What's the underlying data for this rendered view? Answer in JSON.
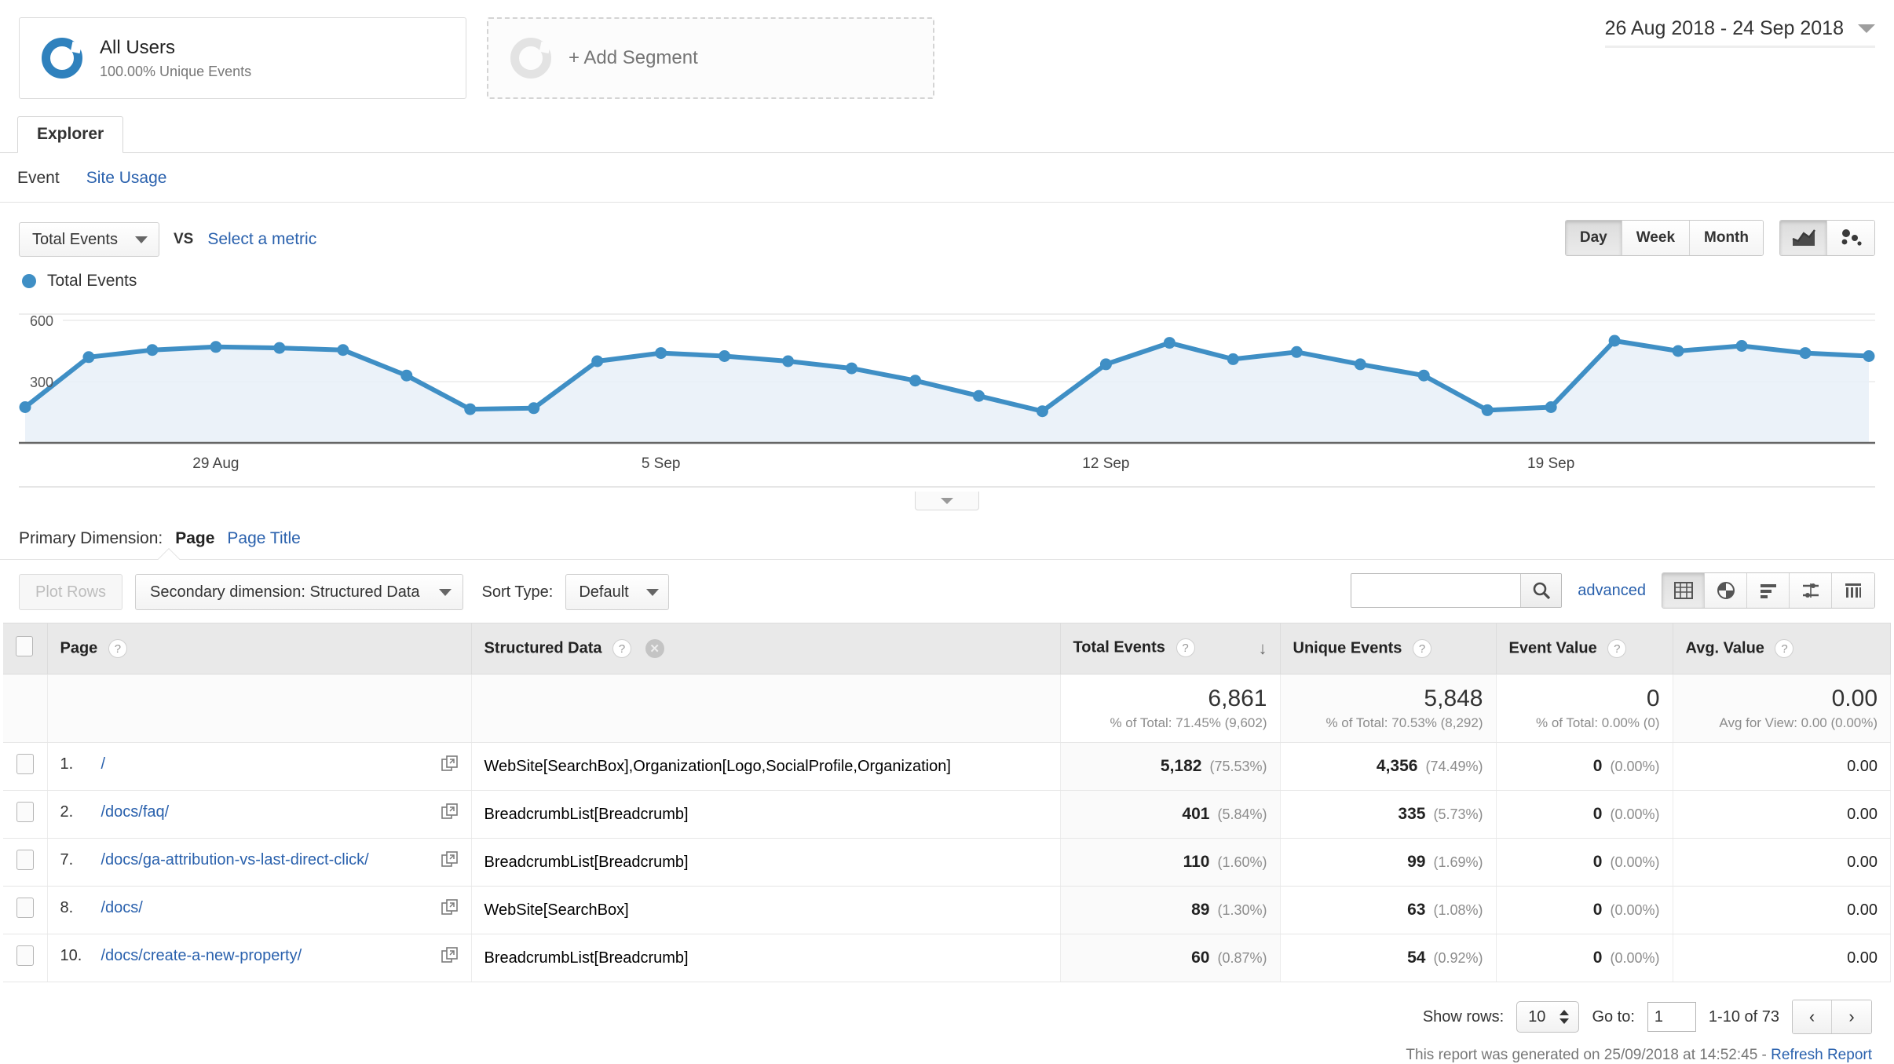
{
  "segments": [
    {
      "name": "All Users",
      "sub": "100.00% Unique Events"
    },
    {
      "name": "+ Add Segment"
    }
  ],
  "date_range": "26 Aug 2018 - 24 Sep 2018",
  "tabs": [
    {
      "label": "Explorer"
    }
  ],
  "subnav": [
    {
      "label": "Event",
      "active": true
    },
    {
      "label": "Site Usage",
      "active": false
    }
  ],
  "metric_row": {
    "metric": "Total Events",
    "vs": "VS",
    "select_metric": "Select a metric",
    "granularity": [
      "Day",
      "Week",
      "Month"
    ],
    "granularity_selected": "Day",
    "chart_type_icons": [
      "line-chart-icon",
      "motion-chart-icon"
    ]
  },
  "legend": {
    "label": "Total Events",
    "color": "#3f8fc5"
  },
  "chart_data": {
    "type": "area",
    "title": "Total Events",
    "xlabel": "",
    "ylabel": "",
    "ylim": [
      0,
      600
    ],
    "yticks": [
      300,
      600
    ],
    "grid": true,
    "legend": [
      "Total Events"
    ],
    "line_color": "#3f8fc5",
    "fill_color": "#e8f0f8",
    "x": [
      "26 Aug",
      "27 Aug",
      "28 Aug",
      "29 Aug",
      "30 Aug",
      "31 Aug",
      "1 Sep",
      "2 Sep",
      "3 Sep",
      "4 Sep",
      "5 Sep",
      "6 Sep",
      "7 Sep",
      "8 Sep",
      "9 Sep",
      "10 Sep",
      "11 Sep",
      "12 Sep",
      "13 Sep",
      "14 Sep",
      "15 Sep",
      "16 Sep",
      "17 Sep",
      "18 Sep",
      "19 Sep",
      "20 Sep",
      "21 Sep",
      "22 Sep",
      "23 Sep",
      "24 Sep"
    ],
    "xtick_labels": [
      "29 Aug",
      "5 Sep",
      "12 Sep",
      "19 Sep"
    ],
    "xtick_indices": [
      3,
      10,
      17,
      24
    ],
    "values": [
      175,
      420,
      455,
      470,
      465,
      455,
      330,
      165,
      170,
      400,
      440,
      425,
      400,
      365,
      305,
      230,
      155,
      385,
      490,
      410,
      445,
      385,
      330,
      160,
      175,
      500,
      450,
      475,
      440,
      425
    ]
  },
  "primary_dimension": {
    "label": "Primary Dimension:",
    "options": [
      {
        "label": "Page",
        "active": true
      },
      {
        "label": "Page Title",
        "active": false
      }
    ]
  },
  "table_controls": {
    "plot_rows": "Plot Rows",
    "secondary_dimension": "Secondary dimension: Structured Data",
    "sort_type_label": "Sort Type:",
    "sort_type_value": "Default",
    "search_placeholder": "",
    "search_value": "",
    "advanced": "advanced",
    "view_icons": [
      "table-view-icon",
      "pie-chart-view-icon",
      "bar-chart-view-icon",
      "comparison-view-icon",
      "pivot-view-icon"
    ],
    "view_selected": "table-view-icon"
  },
  "table": {
    "columns": [
      {
        "key": "page",
        "label": "Page",
        "help": "?"
      },
      {
        "key": "structured",
        "label": "Structured Data",
        "help": "?",
        "removable": true
      },
      {
        "key": "total_events",
        "label": "Total Events",
        "help": "?",
        "sorted": "desc"
      },
      {
        "key": "unique_events",
        "label": "Unique Events",
        "help": "?"
      },
      {
        "key": "event_value",
        "label": "Event Value",
        "help": "?"
      },
      {
        "key": "avg_value",
        "label": "Avg. Value",
        "help": "?"
      }
    ],
    "summary": {
      "total_events": {
        "value": "6,861",
        "sub": "% of Total: 71.45% (9,602)"
      },
      "unique_events": {
        "value": "5,848",
        "sub": "% of Total: 70.53% (8,292)"
      },
      "event_value": {
        "value": "0",
        "sub": "% of Total: 0.00% (0)"
      },
      "avg_value": {
        "value": "0.00",
        "sub": "Avg for View: 0.00 (0.00%)"
      }
    },
    "rows": [
      {
        "index": "1.",
        "page": "/",
        "structured": "WebSite[SearchBox],Organization[Logo,SocialProfile,Organization]",
        "total_events": "5,182",
        "total_events_pct": "(75.53%)",
        "unique_events": "4,356",
        "unique_events_pct": "(74.49%)",
        "event_value": "0",
        "event_value_pct": "(0.00%)",
        "avg_value": "0.00"
      },
      {
        "index": "2.",
        "page": "/docs/faq/",
        "structured": "BreadcrumbList[Breadcrumb]",
        "total_events": "401",
        "total_events_pct": "(5.84%)",
        "unique_events": "335",
        "unique_events_pct": "(5.73%)",
        "event_value": "0",
        "event_value_pct": "(0.00%)",
        "avg_value": "0.00"
      },
      {
        "index": "7.",
        "page": "/docs/ga-attribution-vs-last-direct-click/",
        "structured": "BreadcrumbList[Breadcrumb]",
        "total_events": "110",
        "total_events_pct": "(1.60%)",
        "unique_events": "99",
        "unique_events_pct": "(1.69%)",
        "event_value": "0",
        "event_value_pct": "(0.00%)",
        "avg_value": "0.00"
      },
      {
        "index": "8.",
        "page": "/docs/",
        "structured": "WebSite[SearchBox]",
        "total_events": "89",
        "total_events_pct": "(1.30%)",
        "unique_events": "63",
        "unique_events_pct": "(1.08%)",
        "event_value": "0",
        "event_value_pct": "(0.00%)",
        "avg_value": "0.00"
      },
      {
        "index": "10.",
        "page": "/docs/create-a-new-property/",
        "structured": "BreadcrumbList[Breadcrumb]",
        "total_events": "60",
        "total_events_pct": "(0.87%)",
        "unique_events": "54",
        "unique_events_pct": "(0.92%)",
        "event_value": "0",
        "event_value_pct": "(0.00%)",
        "avg_value": "0.00"
      }
    ]
  },
  "footer": {
    "show_rows_label": "Show rows:",
    "show_rows_value": "10",
    "goto_label": "Go to:",
    "goto_value": "1",
    "range": "1-10 of 73",
    "generated_text": "This report was generated on 25/09/2018 at 14:52:45 - ",
    "refresh_label": "Refresh Report"
  }
}
